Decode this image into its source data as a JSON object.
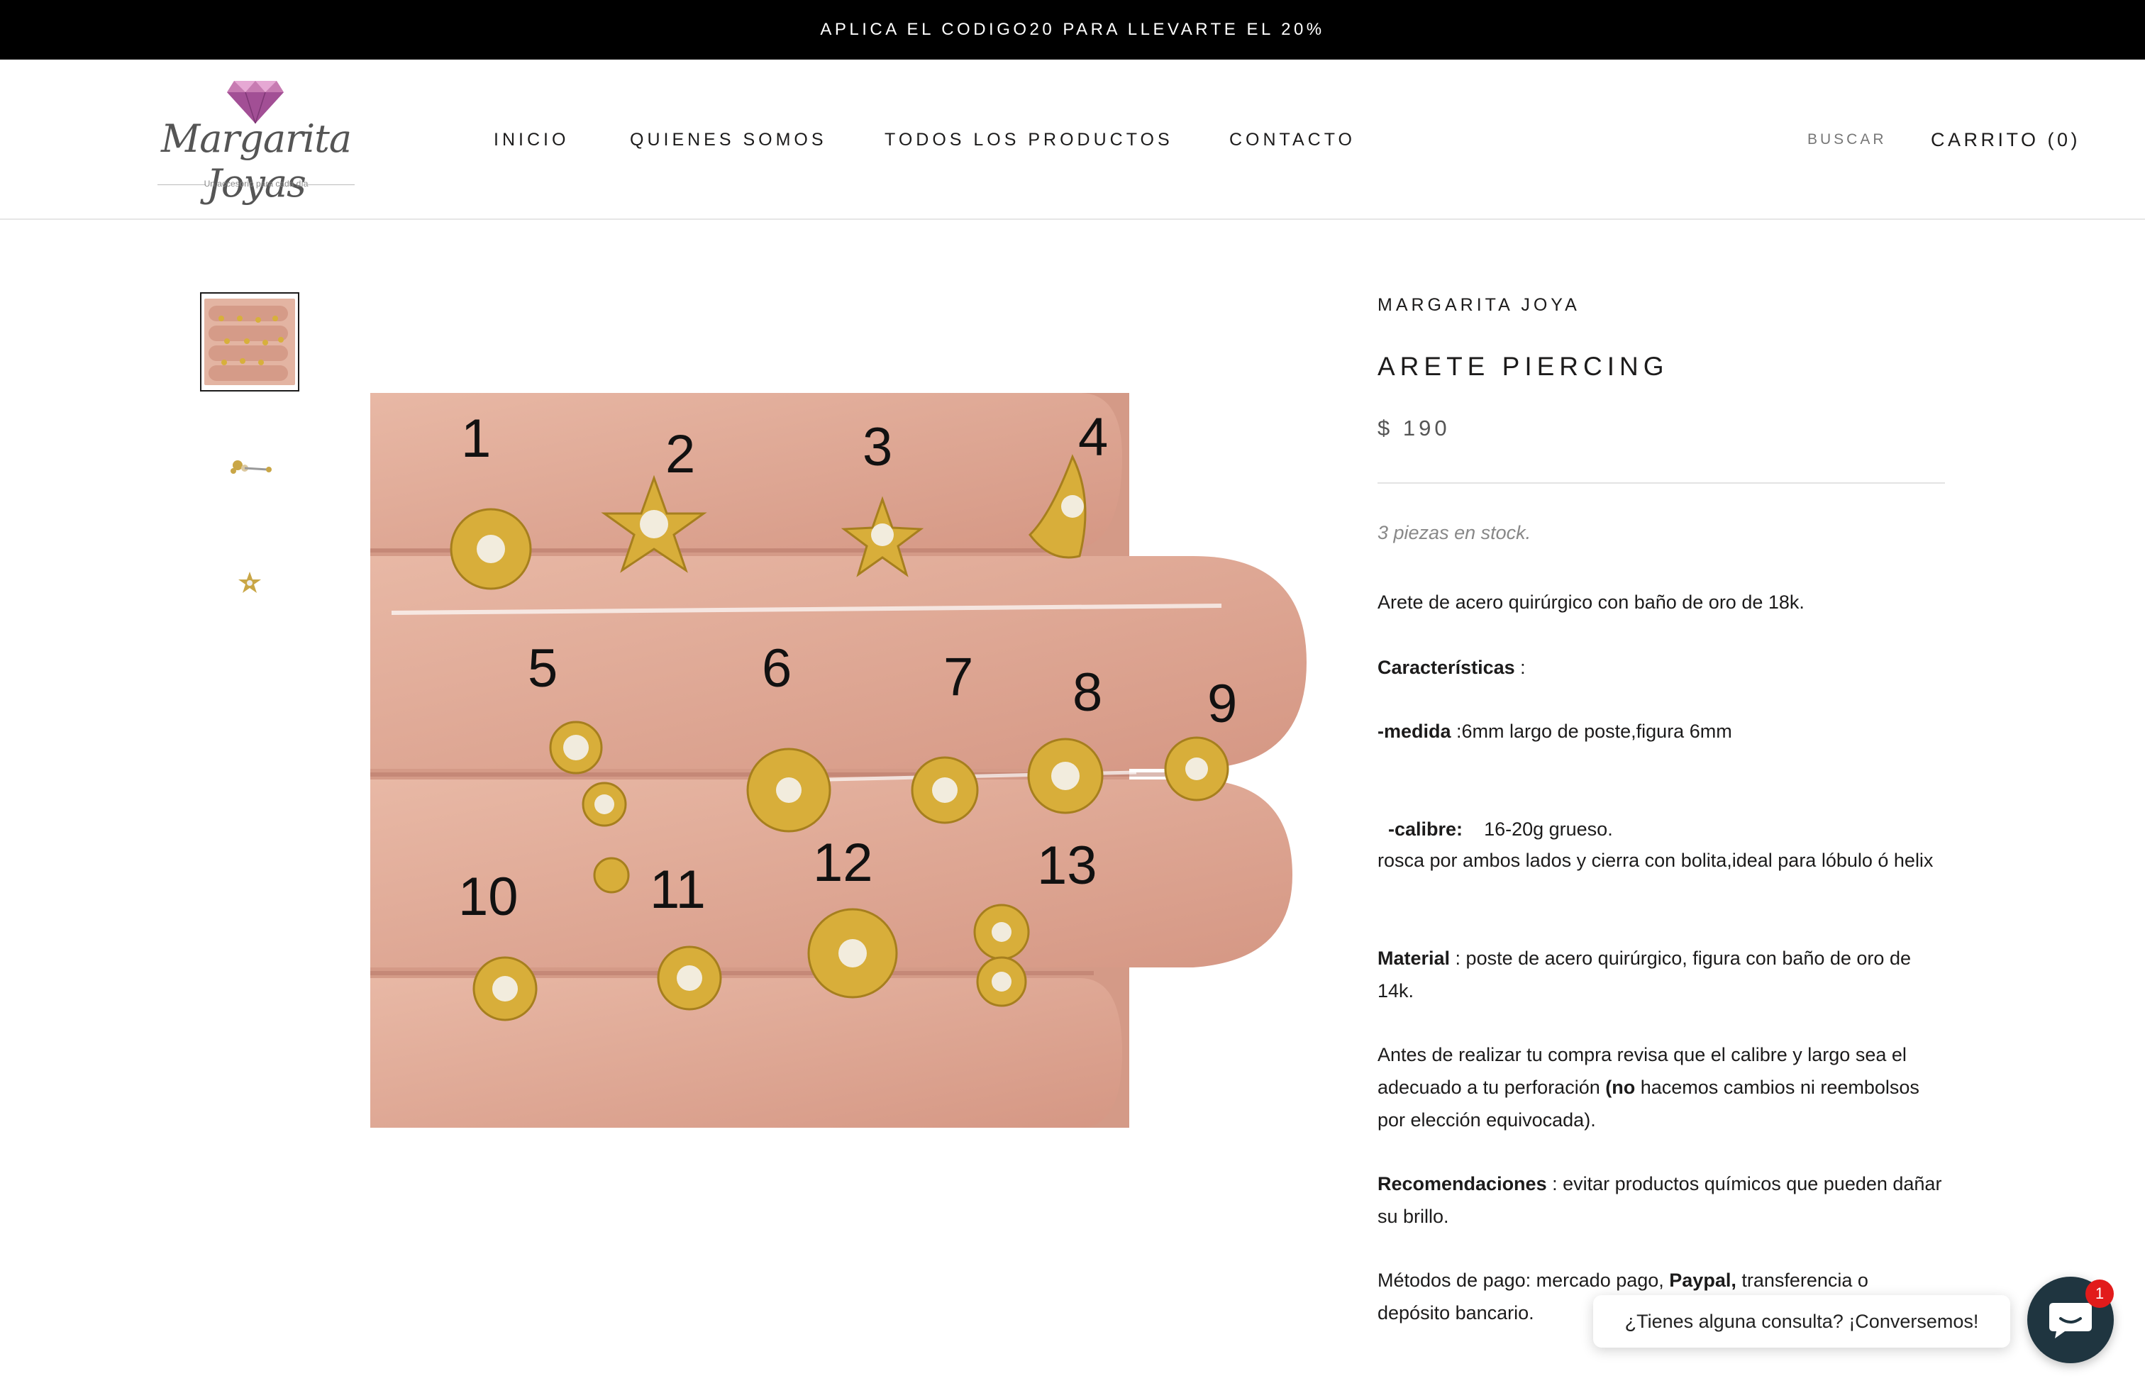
{
  "announcement": "APLICA EL CODIGO20 PARA LLEVARTE EL 20%",
  "logo": {
    "name": "Margarita Joyas",
    "tagline": "Un accesorio para cada día"
  },
  "nav": {
    "items": [
      "INICIO",
      "QUIENES SOMOS",
      "TODOS LOS PRODUCTOS",
      "CONTACTO"
    ]
  },
  "header": {
    "search_label": "BUSCAR",
    "cart_label": "CARRITO (0)"
  },
  "gallery": {
    "image_numbers": [
      "1",
      "2",
      "3",
      "4",
      "5",
      "6",
      "7",
      "8",
      "9",
      "10",
      "11",
      "12",
      "13"
    ]
  },
  "product": {
    "vendor": "MARGARITA JOYA",
    "title": "ARETE PIERCING",
    "price": "$ 190",
    "stock": "3 piezas en stock.",
    "description": {
      "intro": "Arete de acero quirúrgico con baño de oro de 18k.",
      "features_heading": "Características",
      "features_suffix": " :",
      "medida_label": "-medida",
      "medida_value": " :6mm largo de poste,figura 6mm",
      "calibre_label": "-calibre:",
      "calibre_value": "    16-20g grueso.",
      "rosca": "rosca por ambos lados y cierra con bolita,ideal para lóbulo ó helix",
      "material_label": "Material",
      "material_value": " : poste de acero quirúrgico, figura con baño de oro de 14k.",
      "antes_1": "Antes de realizar tu compra revisa que el calibre y largo sea el adecuado a tu perforación ",
      "antes_bold": "(no",
      "antes_2": " hacemos cambios ni reembolsos por elección equivocada).",
      "recom_label": "Recomendaciones",
      "recom_value": " : evitar productos químicos que pueden dañar su brillo.",
      "pago_1": "Métodos de pago: mercado pago, ",
      "pago_bold": "Paypal,",
      "pago_2": " transferencia o depósito bancario."
    }
  },
  "chat": {
    "prompt": "¿Tienes alguna consulta? ¡Conversemos!",
    "badge": "1"
  },
  "colors": {
    "announcement_bg": "#000000",
    "chat_button": "#1f3540",
    "badge": "#e21b1b",
    "gold": "#d7b03c"
  }
}
